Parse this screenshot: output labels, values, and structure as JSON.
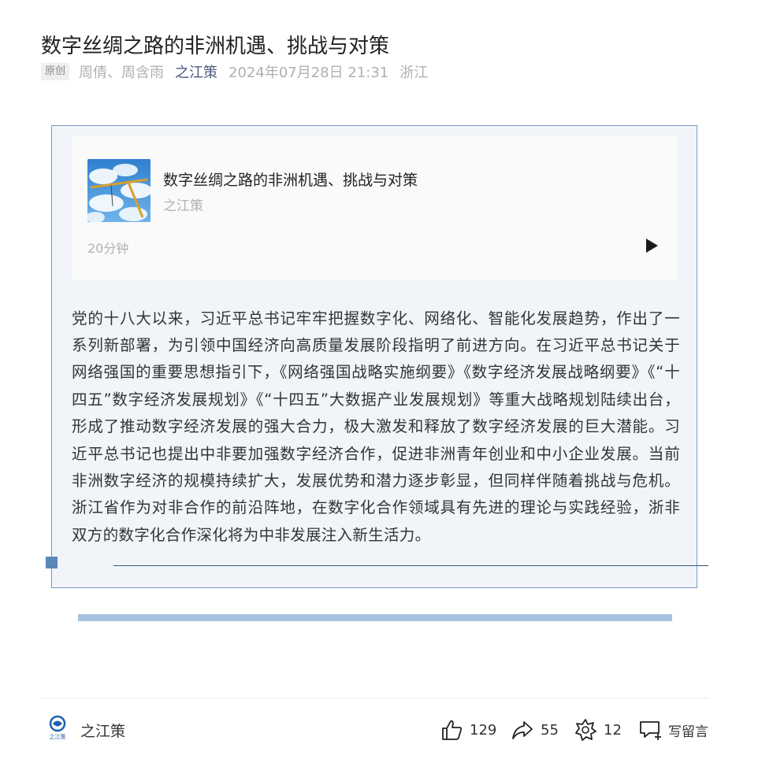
{
  "article": {
    "title": "数字丝绸之路的非洲机遇、挑战与对策",
    "badge": "原创",
    "authors": "周倩、周含雨",
    "account": "之江策",
    "datetime": "2024年07月28日 21:31",
    "location": "浙江"
  },
  "audio": {
    "title": "数字丝绸之路的非洲机遇、挑战与对策",
    "source": "之江策",
    "duration": "20分钟",
    "play_icon": "play-icon"
  },
  "body": {
    "paragraph": "党的十八大以来，习近平总书记牢牢把握数字化、网络化、智能化发展趋势，作出了一系列新部署，为引领中国经济向高质量发展阶段指明了前进方向。在习近平总书记关于网络强国的重要思想指引下，《网络强国战略实施纲要》《数字经济发展战略纲要》《“十四五”数字经济发展规划》《“十四五”大数据产业发展规划》等重大战略规划陆续出台，形成了推动数字经济发展的强大合力，极大激发和释放了数字经济发展的巨大潜能。习近平总书记也提出中非要加强数字经济合作，促进非洲青年创业和中小企业发展。当前非洲数字经济的规模持续扩大，发展优势和潜力逐步彰显，但同样伴随着挑战与危机。浙江省作为对非合作的前沿阵地，在数字化合作领域具有先进的理论与实践经验，浙非双方的数字化合作深化将为中非发展注入新生活力。"
  },
  "footer": {
    "account": "之江策",
    "logo_text": "之江策",
    "likes": "129",
    "shares": "55",
    "wow": "12",
    "comment_label": "写留言"
  },
  "colors": {
    "quote_bg": "#f1f5fa",
    "quote_border": "#7a9cc4",
    "deco_square": "#5b87b8",
    "deco_bar": "#a7c2e0",
    "account_link": "#4a5a7a"
  }
}
